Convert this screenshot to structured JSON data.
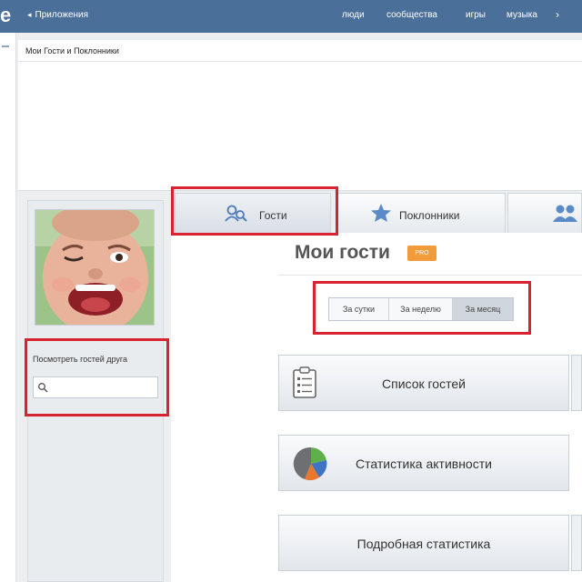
{
  "topbar": {
    "logo": "e",
    "breadcrumb": "Приложения",
    "nav": [
      "люди",
      "сообщества",
      "игры",
      "музыка"
    ]
  },
  "app": {
    "title": "Мои Гости и Поклонники"
  },
  "sidebar": {
    "friend_label": "Посмотреть гостей друга",
    "search_value": ""
  },
  "tabs": [
    {
      "label": "Гости",
      "icon": "guest-search-icon",
      "active": true
    },
    {
      "label": "Поклонники",
      "icon": "star-icon",
      "active": false
    },
    {
      "label": "",
      "icon": "users-icon",
      "active": false
    }
  ],
  "main": {
    "title": "Мои гости",
    "badge": "PRO",
    "period": [
      {
        "label": "За сутки",
        "active": false
      },
      {
        "label": "За неделю",
        "active": false
      },
      {
        "label": "За месяц",
        "active": true
      }
    ],
    "buttons": [
      {
        "label": "Список гостей",
        "icon": "clipboard-list-icon"
      },
      {
        "label": "Статистика активности",
        "icon": "pie-chart-icon"
      },
      {
        "label": "Подробная статистика",
        "icon": ""
      }
    ]
  },
  "colors": {
    "topbar": "#4a6f99",
    "highlight": "#d7232f",
    "badge": "#f29b3b",
    "icon_blue": "#4d7ab8"
  }
}
